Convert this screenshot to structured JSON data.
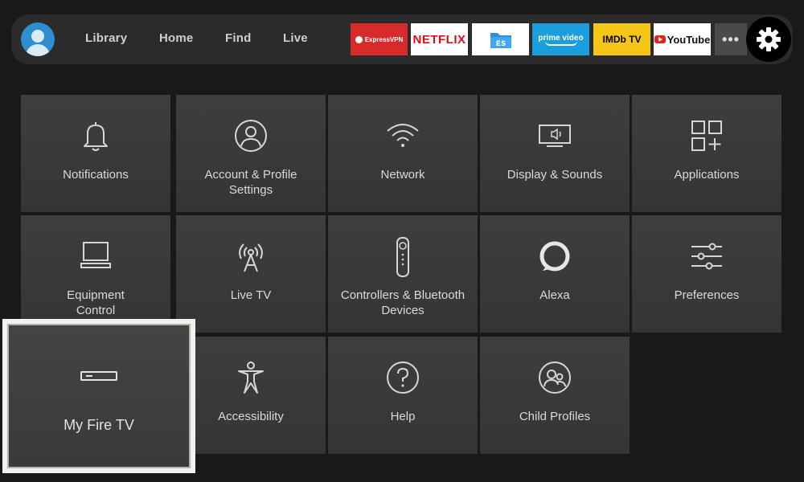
{
  "nav": {
    "items": [
      "Library",
      "Home",
      "Find",
      "Live"
    ]
  },
  "apps": {
    "expressvpn": "ExpressVPN",
    "netflix": "NETFLIX",
    "es": "ES",
    "prime": "prime video",
    "imdb": "IMDb TV",
    "youtube": "YouTube",
    "more": "•••"
  },
  "settings": {
    "tiles": [
      {
        "label": "Notifications",
        "icon": "bell-icon"
      },
      {
        "label": "Account & Profile",
        "label2": "Settings",
        "icon": "user-circle-icon"
      },
      {
        "label": "Network",
        "icon": "wifi-icon"
      },
      {
        "label": "Display & Sounds",
        "icon": "tv-sound-icon"
      },
      {
        "label": "Applications",
        "icon": "apps-grid-icon"
      },
      {
        "label": "Equipment",
        "label2": "Control",
        "icon": "monitor-icon"
      },
      {
        "label": "Live TV",
        "icon": "antenna-icon"
      },
      {
        "label": "Controllers & Bluetooth",
        "label2": "Devices",
        "icon": "remote-icon"
      },
      {
        "label": "Alexa",
        "icon": "alexa-icon"
      },
      {
        "label": "Preferences",
        "icon": "sliders-icon"
      },
      {
        "label": "My Fire TV",
        "icon": "fire-tv-device-icon",
        "focused": true
      },
      {
        "label": "Accessibility",
        "icon": "accessibility-icon"
      },
      {
        "label": "Help",
        "icon": "help-icon"
      },
      {
        "label": "Child Profiles",
        "icon": "child-profiles-icon"
      }
    ]
  },
  "colors": {
    "background": "#191919",
    "tile": "#3b3b3b",
    "topbar": "#2b2b2b",
    "focus_border": "#f2f2f2",
    "avatar": "#2f8ecf"
  }
}
